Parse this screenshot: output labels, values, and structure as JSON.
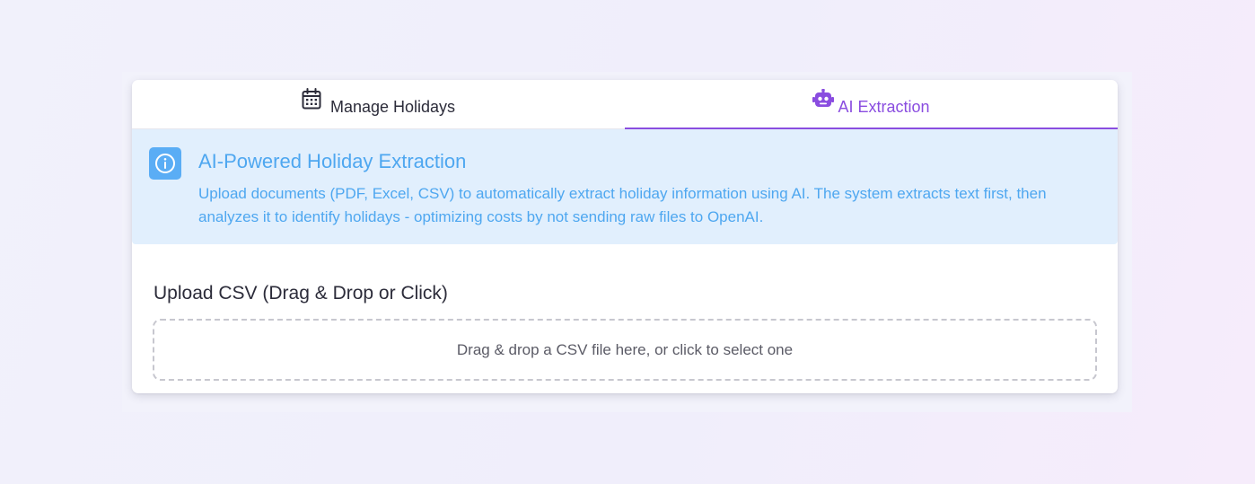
{
  "tabs": [
    {
      "label": "Manage Holidays",
      "icon": "calendar-icon",
      "active": false
    },
    {
      "label": "AI Extraction",
      "icon": "robot-icon",
      "active": true
    }
  ],
  "info": {
    "icon": "info-icon",
    "title": "AI-Powered Holiday Extraction",
    "text": "Upload documents (PDF, Excel, CSV) to automatically extract holiday information using AI. The system extracts text first, then analyzes it to identify holidays - optimizing costs by not sending raw files to OpenAI."
  },
  "upload": {
    "title": "Upload CSV (Drag & Drop or Click)",
    "dropzone_text": "Drag & drop a CSV file here, or click to select one"
  },
  "colors": {
    "accent": "#8a4de0",
    "info_bg": "#e1effd",
    "info_text": "#4ea7f0",
    "info_icon_bg": "#5aadf5"
  }
}
